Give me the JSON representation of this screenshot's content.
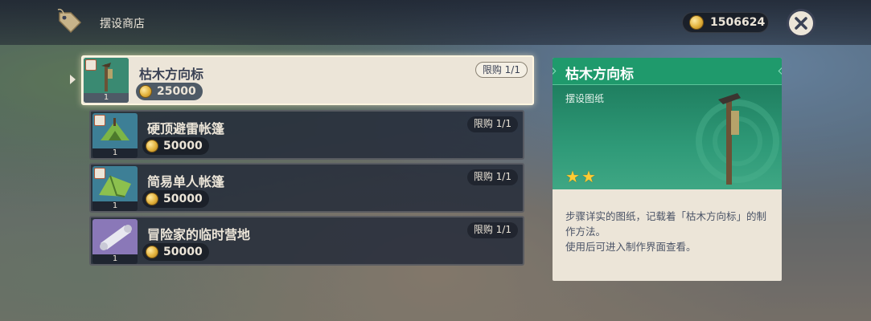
{
  "header": {
    "shop_title": "摆设商店",
    "currency_amount": "1506624",
    "shop_icon": "price-tag-icon",
    "close_icon": "close-icon"
  },
  "items": [
    {
      "name": "枯木方向标",
      "price": "25000",
      "limit": "限购 1/1",
      "count": "1",
      "selected": true,
      "art": "dead-wood-signpost"
    },
    {
      "name": "硬顶避雷帐篷",
      "price": "50000",
      "limit": "限购 1/1",
      "count": "1",
      "selected": false,
      "art": "tent-green"
    },
    {
      "name": "简易单人帐篷",
      "price": "50000",
      "limit": "限购 1/1",
      "count": "1",
      "selected": false,
      "art": "tent-single"
    },
    {
      "name": "冒险家的临时营地",
      "price": "50000",
      "limit": "限购 1/1",
      "count": "1",
      "selected": false,
      "art": "camp-scroll"
    }
  ],
  "detail": {
    "title": "枯木方向标",
    "type": "摆设图纸",
    "stars": 2,
    "description_line1": "步骤详实的图纸，记载着「枯木方向标」的制作方法。",
    "description_line2": "使用后可进入制作界面查看。"
  },
  "colors": {
    "detail_header": "#1f9a6c",
    "panel_bg": "#ece5d8",
    "list_bg": "#242b3a",
    "star": "#ffcc33",
    "coin": "#e3b23c"
  }
}
